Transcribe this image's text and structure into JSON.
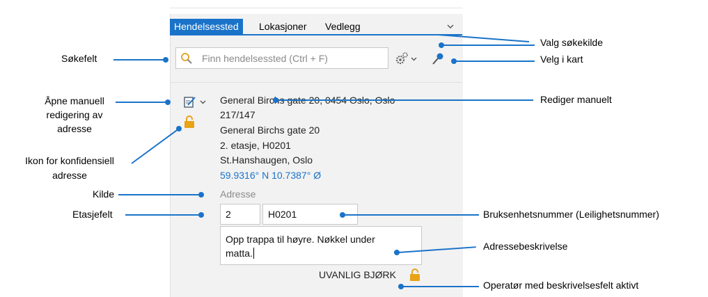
{
  "tabs": [
    {
      "label": "Hendelsessted",
      "active": true
    },
    {
      "label": "Lokasjoner",
      "active": false
    },
    {
      "label": "Vedlegg",
      "active": false
    }
  ],
  "search": {
    "placeholder": "Finn hendelsessted (Ctrl + F)",
    "value": ""
  },
  "address": {
    "lines": [
      "General Birchs gate 20, 0454 Oslo, Oslo",
      "217/147",
      "General Birchs gate 20",
      "2. etasje, H0201",
      "St.Hanshaugen, Oslo"
    ],
    "coordinates": "59.9316° N 10.7387° Ø",
    "source": "Adresse",
    "floor": "2",
    "unit_number": "H0201",
    "description_line1": "Opp trappa til høyre. Nøkkel under",
    "description_line2": "matta.",
    "operator": "UVANLIG BJØRK"
  },
  "callouts": {
    "sokefelt": "Søkefelt",
    "apne_line1": "Åpne manuell",
    "apne_line2": "redigering av",
    "apne_line3": "adresse",
    "ikon_line1": "Ikon for konfidensiell",
    "ikon_line2": "adresse",
    "kilde": "Kilde",
    "etasjefelt": "Etasjefelt",
    "valg_sokekilde": "Valg søkekilde",
    "velg_i_kart": "Velg i kart",
    "rediger_manuelt": "Rediger manuelt",
    "bruksenhetsnummer": "Bruksenhetsnummer (Leilighetsnummer)",
    "adressebeskrivelse": "Adressebeskrivelse",
    "operator_aktiv": "Operatør med beskrivelsesfelt aktivt"
  },
  "colors": {
    "accent": "#1a73c9",
    "lock": "#e8a317"
  }
}
